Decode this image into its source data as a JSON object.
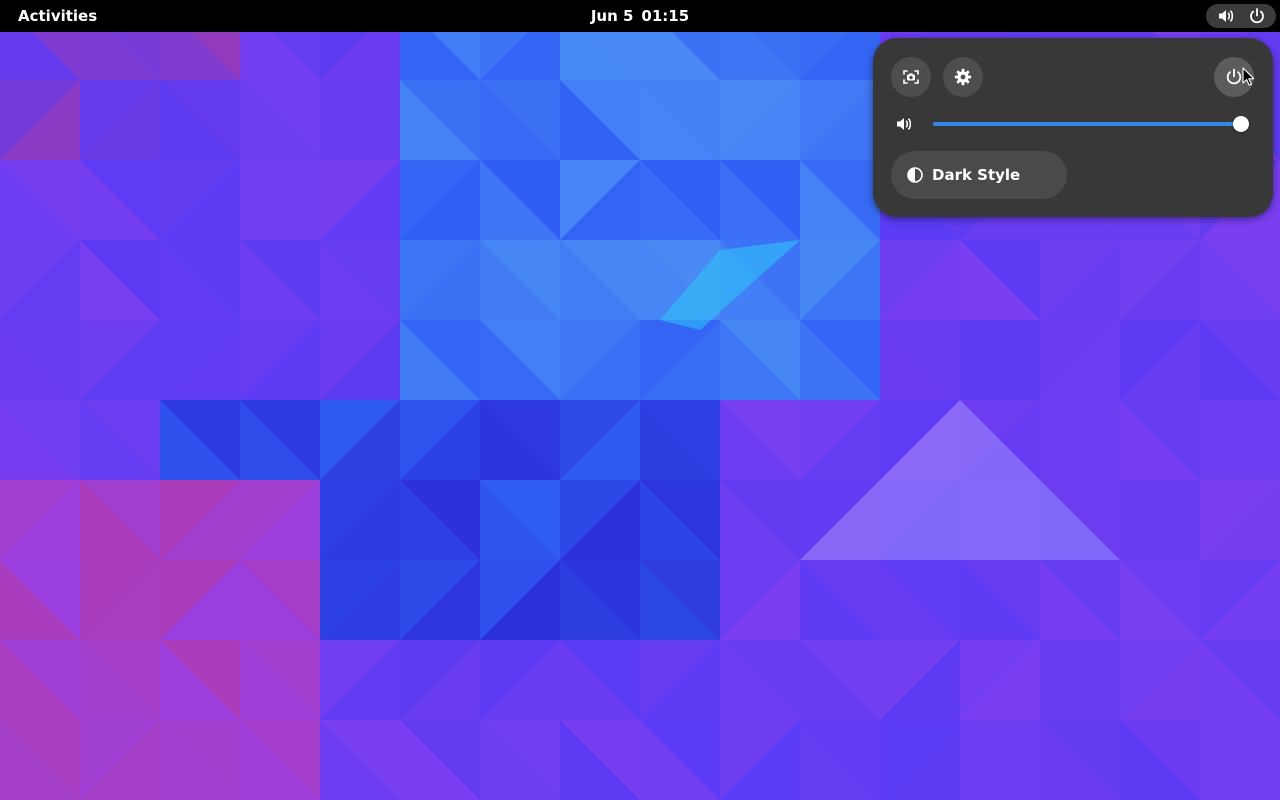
{
  "topbar": {
    "activities_label": "Activities",
    "date": "Jun 5",
    "time": "01:15",
    "status_icons": [
      "volume-icon",
      "power-icon"
    ],
    "background": "#000000"
  },
  "quick_settings": {
    "buttons": [
      "screenshot-icon",
      "gear-icon",
      "power-icon"
    ],
    "volume": {
      "icon": "speaker-high-icon",
      "level": 1.0
    },
    "dark_style": {
      "label": "Dark Style",
      "icon": "half-circle-contrast-icon",
      "active": false
    },
    "accent_color": "#3584e4",
    "panel_background": "#383838"
  },
  "wallpaper": {
    "style": "low-poly triangles",
    "colors": [
      "#5b3bf3",
      "#7b3ff0",
      "#2f5df5",
      "#4a8cf5",
      "#9a3fe0",
      "#b83a9a",
      "#2c2fd8"
    ]
  }
}
